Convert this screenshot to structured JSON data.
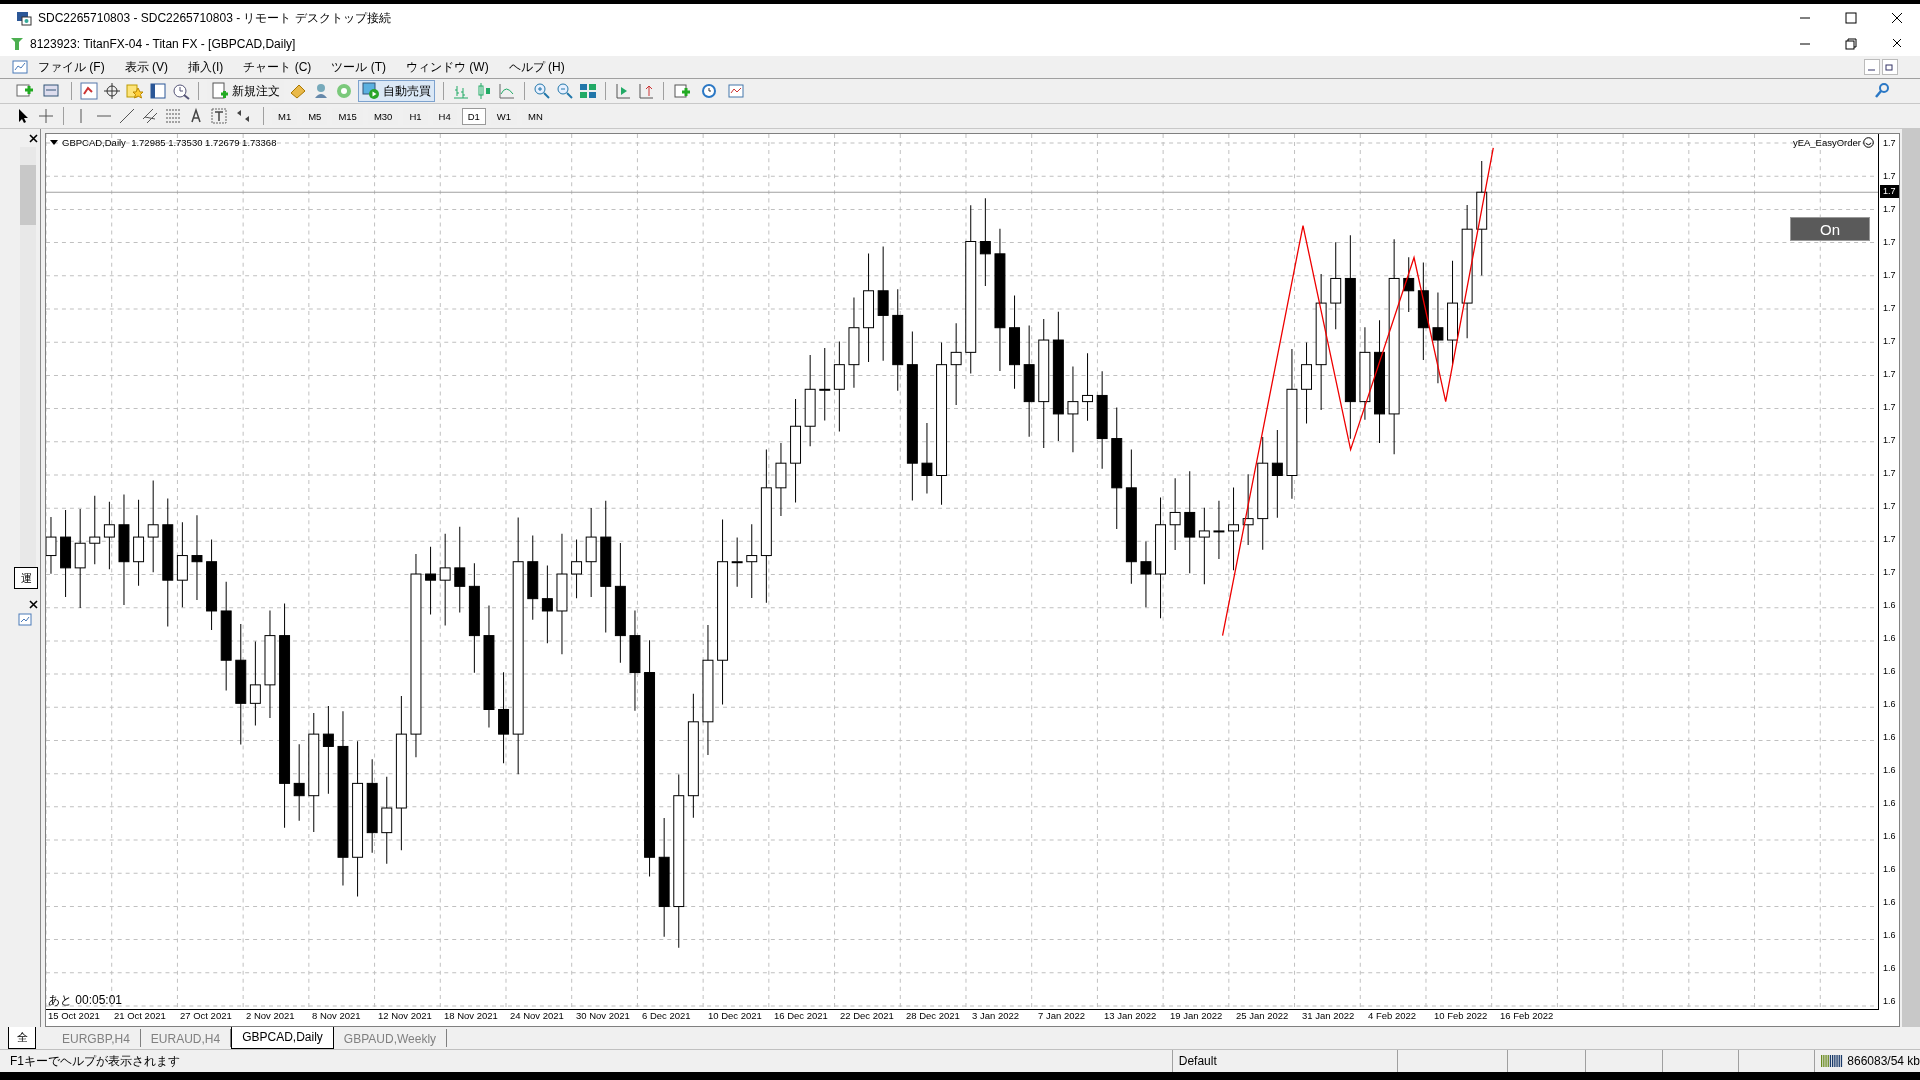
{
  "remote_window": {
    "title": "SDC2265710803 - SDC2265710803 - リモート デスクトップ接続"
  },
  "app_window": {
    "title": "8123923: TitanFX-04 - Titan FX - [GBPCAD,Daily]"
  },
  "menu": [
    "ファイル (F)",
    "表示 (V)",
    "挿入(I)",
    "チャート (C)",
    "ツール (T)",
    "ウィンドウ (W)",
    "ヘルプ (H)"
  ],
  "toolbar": {
    "new_order": "新規注文",
    "auto_trading": {
      "label": "自動売買",
      "on": true
    }
  },
  "timeframes": [
    {
      "label": "M1",
      "selected": false
    },
    {
      "label": "M5",
      "selected": false
    },
    {
      "label": "M15",
      "selected": false
    },
    {
      "label": "M30",
      "selected": false
    },
    {
      "label": "H1",
      "selected": false
    },
    {
      "label": "H4",
      "selected": false
    },
    {
      "label": "D1",
      "selected": true
    },
    {
      "label": "W1",
      "selected": false
    },
    {
      "label": "MN",
      "selected": false
    }
  ],
  "side_panel": {
    "tab": "運",
    "bottom_tab": "全"
  },
  "chart": {
    "header": "GBPCAD,Daily  1.72985 1.73530 1.72679 1.73368",
    "expert": "yEA_EasyOrder",
    "on_button": "On",
    "countdown": "あと 00:05:01",
    "current_price": "1.7",
    "price_labels": [
      "1.7",
      "1.7",
      "1.7",
      "1.7",
      "1.7",
      "1.7",
      "1.7",
      "1.7",
      "1.7",
      "1.7",
      "1.7",
      "1.7",
      "1.7",
      "1.7",
      "1.6",
      "1.6",
      "1.6",
      "1.6",
      "1.6",
      "1.6",
      "1.6",
      "1.6",
      "1.6",
      "1.6",
      "1.6",
      "1.6",
      "1.6"
    ],
    "dates": [
      "15 Oct 2021",
      "21 Oct 2021",
      "27 Oct 2021",
      "2 Nov 2021",
      "8 Nov 2021",
      "12 Nov 2021",
      "18 Nov 2021",
      "24 Nov 2021",
      "30 Nov 2021",
      "6 Dec 2021",
      "10 Dec 2021",
      "16 Dec 2021",
      "22 Dec 2021",
      "28 Dec 2021",
      "3 Jan 2022",
      "7 Jan 2022",
      "13 Jan 2022",
      "19 Jan 2022",
      "25 Jan 2022",
      "31 Jan 2022",
      "4 Feb 2022",
      "10 Feb 2022",
      "16 Feb 2022"
    ]
  },
  "chart_tabs": [
    {
      "label": "EURGBP,H4",
      "selected": false
    },
    {
      "label": "EURAUD,H4",
      "selected": false
    },
    {
      "label": "GBPCAD,Daily",
      "selected": true
    },
    {
      "label": "GBPAUD,Weekly",
      "selected": false
    }
  ],
  "status_bar": {
    "help": "F1キーでヘルプが表示されます",
    "profile": "Default",
    "traffic": "866083/54 kb"
  }
}
